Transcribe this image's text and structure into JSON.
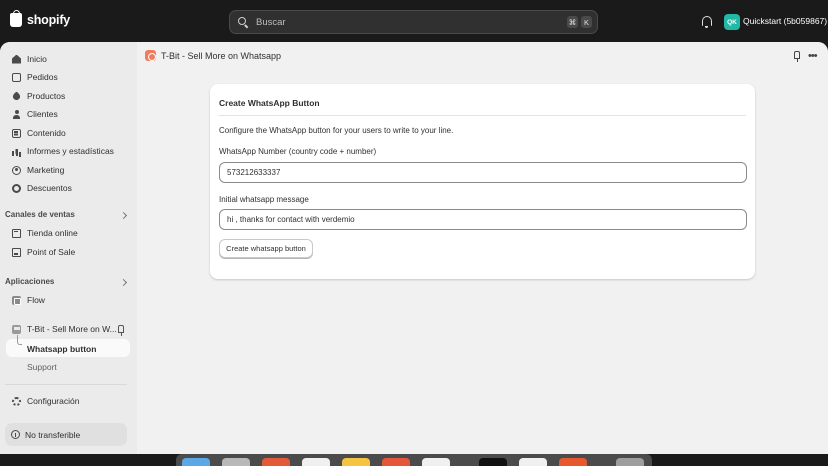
{
  "topbar": {
    "logo_text": "shopify",
    "search_placeholder": "Buscar",
    "shortcut_key1": "⌘",
    "shortcut_key2": "K",
    "store_initials": "QK",
    "store_name": "Quickstart (5b059867)"
  },
  "sidebar": {
    "items": [
      {
        "label": "Inicio",
        "icon": "home-icon"
      },
      {
        "label": "Pedidos",
        "icon": "orders-icon"
      },
      {
        "label": "Productos",
        "icon": "tag-icon"
      },
      {
        "label": "Clientes",
        "icon": "person-icon"
      },
      {
        "label": "Contenido",
        "icon": "content-icon"
      },
      {
        "label": "Informes y estadísticas",
        "icon": "chart-icon"
      },
      {
        "label": "Marketing",
        "icon": "target-icon"
      },
      {
        "label": "Descuentos",
        "icon": "discount-icon"
      }
    ],
    "sales_channels_label": "Canales de ventas",
    "sales_channels": [
      {
        "label": "Tienda online",
        "icon": "store-icon"
      },
      {
        "label": "Point of Sale",
        "icon": "pos-icon"
      }
    ],
    "apps_label": "Aplicaciones",
    "apps": [
      {
        "label": "Flow",
        "icon": "flow-icon"
      }
    ],
    "pinned_app_label": "T-Bit - Sell More on W...",
    "sub_items": [
      {
        "label": "Whatsapp button",
        "active": true
      },
      {
        "label": "Support",
        "active": false
      }
    ],
    "settings_label": "Configuración",
    "non_transferable_label": "No transferible"
  },
  "main": {
    "app_title": "T-Bit - Sell More on Whatsapp",
    "card": {
      "title": "Create WhatsApp Button",
      "description": "Configure the WhatsApp button for your users to write to your line.",
      "number_label": "WhatsApp Number (country code + number)",
      "number_value": "573212633337",
      "message_label": "Initial whatsapp message",
      "message_value": "hi , thanks for contact with verdemio",
      "button_label": "Create whatsapp button"
    }
  },
  "colors": {
    "accent_app": "#f27b5d",
    "store_avatar": "#22b8a6",
    "topbar": "#1a1a1a"
  }
}
